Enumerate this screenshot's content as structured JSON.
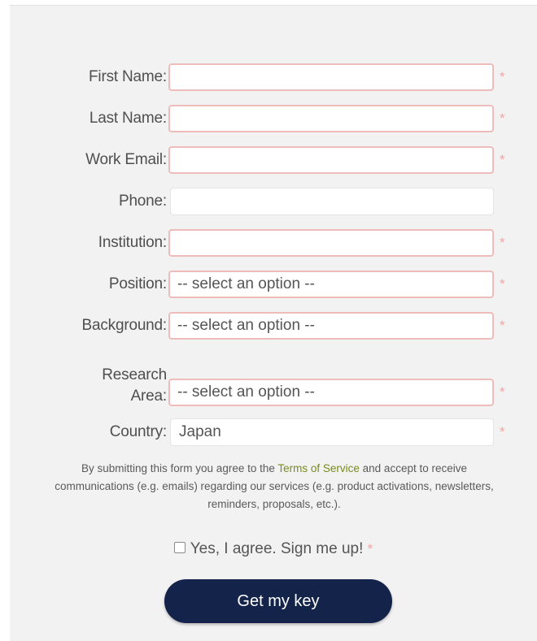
{
  "form": {
    "fields": [
      {
        "label": "First Name:",
        "value": "",
        "required": true
      },
      {
        "label": "Last Name:",
        "value": "",
        "required": true
      },
      {
        "label": "Work Email:",
        "value": "",
        "required": true
      },
      {
        "label": "Phone:",
        "value": "",
        "required": false
      },
      {
        "label": "Institution:",
        "value": "",
        "required": true
      },
      {
        "label": "Position:",
        "value": "-- select an option --",
        "required": true
      },
      {
        "label": "Background:",
        "value": "-- select an option --",
        "required": true
      },
      {
        "label_line1": "Research",
        "label_line2": "Area:",
        "value": "-- select an option --",
        "required": true
      },
      {
        "label": "Country:",
        "value": "Japan",
        "required": true
      }
    ],
    "required_marker": "*",
    "legal": {
      "text_before": "By submitting this form you agree to the ",
      "terms_link": "Terms of Service",
      "text_after": " and accept to receive communications (e.g. emails) regarding our services (e.g. product activations, newsletters, reminders, proposals, etc.)."
    },
    "consent_label": "Yes, I agree. Sign me up!",
    "submit_label": "Get my key"
  },
  "colors": {
    "button_bg": "#13234a",
    "required_border": "#efbcbc",
    "required_star": "#f3a4a4",
    "link": "#7a8a1e",
    "panel_bg": "#f2f2f2"
  }
}
